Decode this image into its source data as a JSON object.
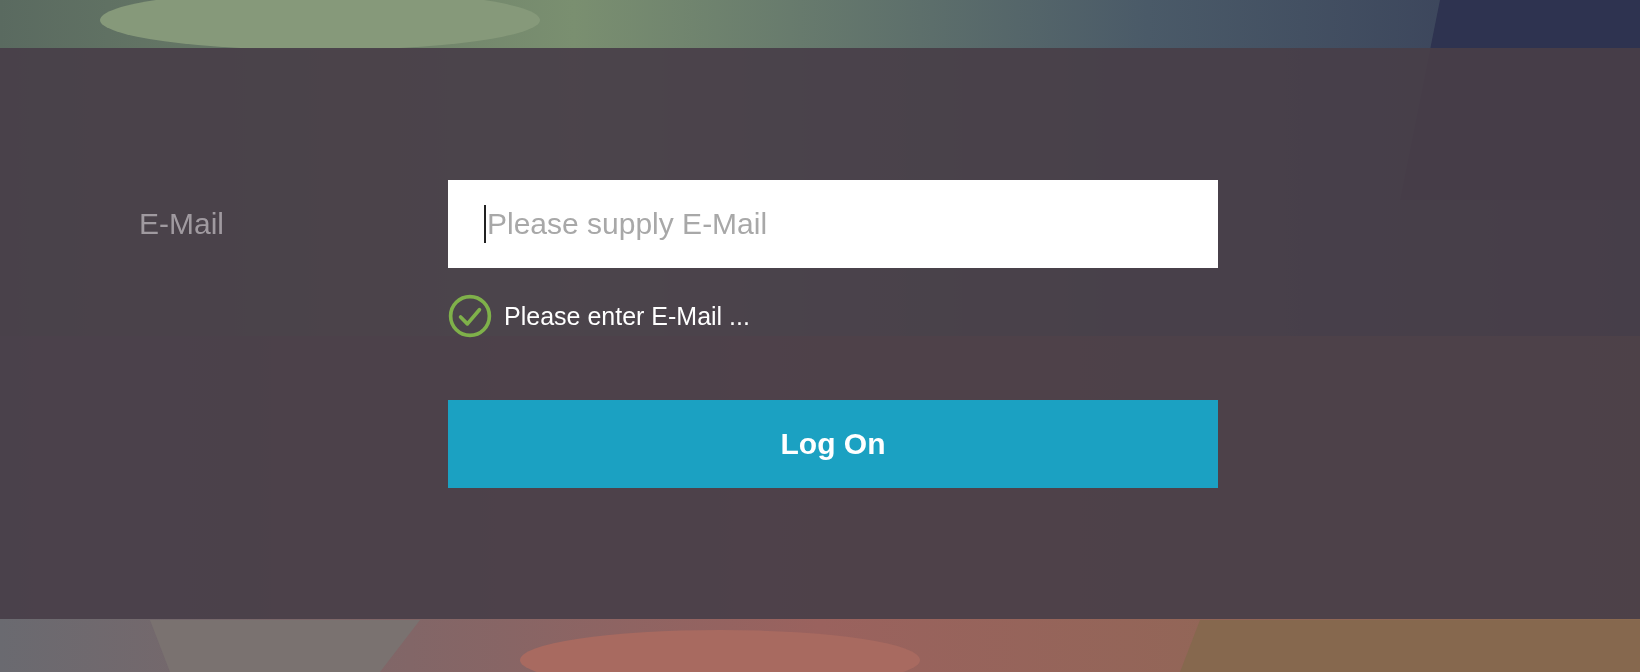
{
  "form": {
    "label": "E-Mail",
    "field": {
      "placeholder": "Please supply E-Mail"
    },
    "hint": {
      "valid": true,
      "text": "Please enter E-Mail ..."
    },
    "button": "Log On"
  }
}
